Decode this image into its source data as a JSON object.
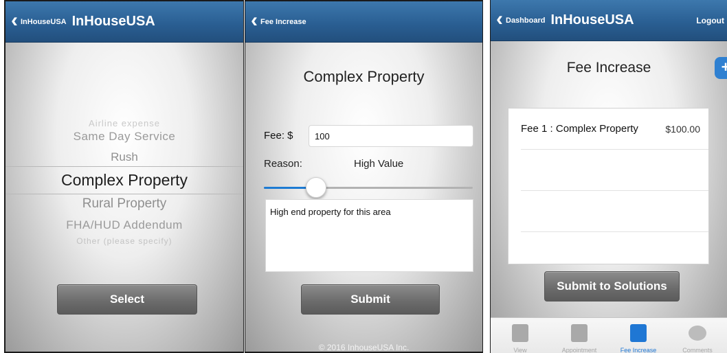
{
  "screen1": {
    "nav": {
      "back_label": "InHouseUSA",
      "title": "InHouseUSA"
    },
    "picker": {
      "options": [
        "Airline expense",
        "Same Day Service",
        "Rush",
        "Complex Property",
        "Rural Property",
        "FHA/HUD Addendum",
        "Other (please specify)"
      ],
      "selected": "Complex Property"
    },
    "select_label": "Select"
  },
  "screen2": {
    "nav": {
      "back_label": "Fee Increase"
    },
    "heading": "Complex Property",
    "fee_label": "Fee: $",
    "fee_value": "100",
    "reason_label": "Reason:",
    "reason_value": "High Value",
    "slider_value": 0.25,
    "comment": "High end property for this area",
    "submit_label": "Submit",
    "footer": "© 2016 InhouseUSA Inc."
  },
  "screen3": {
    "nav": {
      "back_label": "Dashboard",
      "title": "InHouseUSA",
      "logout_label": "Logout"
    },
    "heading": "Fee Increase",
    "fees": [
      {
        "name": "Fee 1 : Complex Property",
        "amount": "$100.00"
      }
    ],
    "submit_label": "Submit to Solutions",
    "tabs": [
      {
        "label": "View",
        "icon": "calendar-icon",
        "active": false
      },
      {
        "label": "Appointment",
        "icon": "calendar-icon",
        "active": false
      },
      {
        "label": "Fee Increase",
        "icon": "calendar-icon",
        "active": true
      },
      {
        "label": "Comments",
        "icon": "speech-bubble-icon",
        "active": false
      }
    ],
    "accent_color": "#1f77d4"
  }
}
